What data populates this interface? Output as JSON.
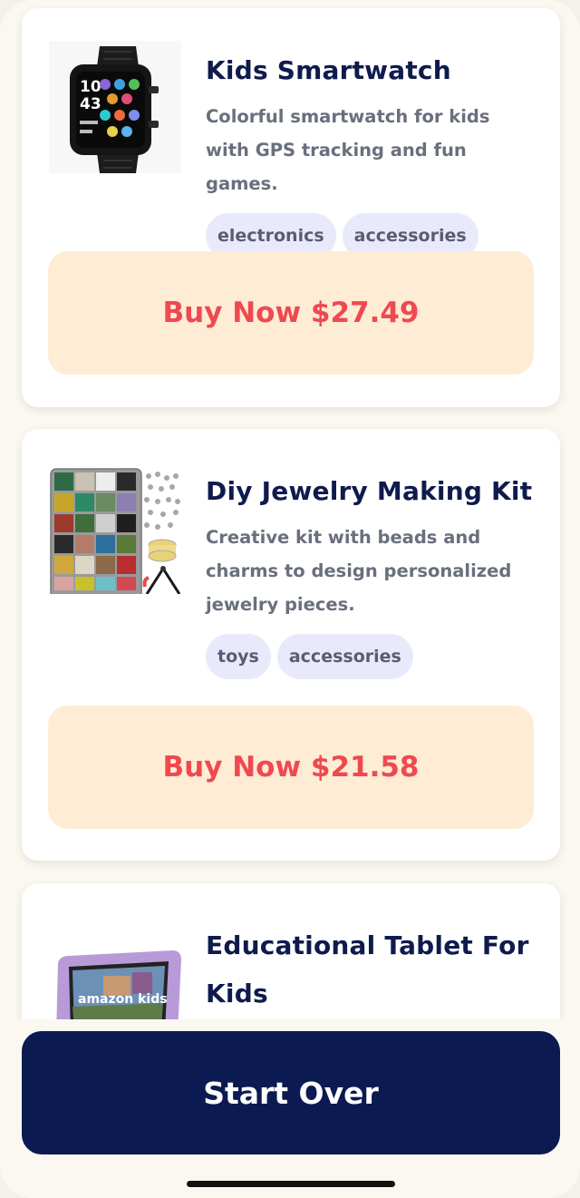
{
  "products": [
    {
      "title": "Kids Smartwatch",
      "description": "Colorful smartwatch for kids with GPS tracking and fun games.",
      "tags": [
        "electronics",
        "accessories"
      ],
      "buy_label": "Buy Now $27.49",
      "watch_time": "10 43"
    },
    {
      "title": "Diy Jewelry Making Kit",
      "description": "Creative kit with beads and charms to design personalized jewelry pieces.",
      "tags": [
        "toys",
        "accessories"
      ],
      "buy_label": "Buy Now $21.58"
    },
    {
      "title": "Educational Tablet For Kids",
      "image_text": "amazon kids"
    }
  ],
  "start_over_label": "Start Over",
  "colors": {
    "navy": "#0c1a52",
    "buy_text": "#ef4950",
    "buy_bg": "#feecd5",
    "tag_bg": "#e8eafc",
    "page_bg": "#fbf8f1"
  }
}
